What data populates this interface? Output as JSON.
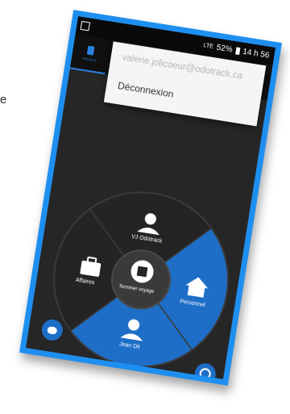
{
  "side_text": "e",
  "status": {
    "signal": "LTE",
    "battery": "52%",
    "time": "14 h 56"
  },
  "tab": {
    "label": "TRAJETS"
  },
  "menu": {
    "email": "valerie.jolicoeur@odotrack.ca",
    "logout": "Déconnexion"
  },
  "dial": {
    "top": "VJ Odotrack",
    "left": "Affaires",
    "right": "Personnel",
    "bottom": "Jean Dit",
    "center": "Terminer voyage"
  },
  "colors": {
    "accent": "#1e6ec8",
    "dark": "#262626",
    "frame": "#1e8ff0"
  },
  "icons": [
    "person-icon",
    "briefcase-icon",
    "home-icon",
    "stop-icon",
    "chat-icon",
    "car-location-icon"
  ]
}
